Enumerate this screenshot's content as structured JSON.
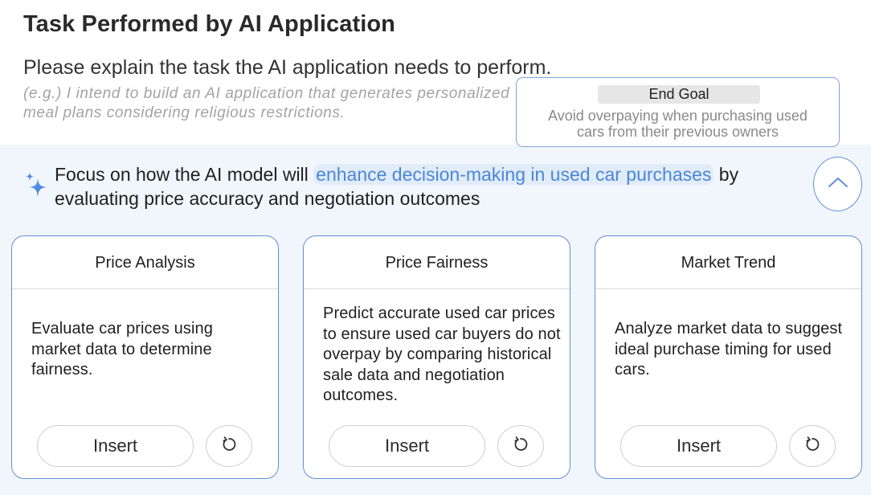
{
  "header": {
    "title": "Task Performed by AI Application",
    "question": "Please explain the task the AI application needs to perform.",
    "placeholder": "(e.g.) I intend to build an AI application that generates personalized meal plans considering religious restrictions."
  },
  "end_goal": {
    "label": "End Goal",
    "text_line1": "Avoid overpaying when purchasing used",
    "text_line2": "cars from their previous owners"
  },
  "focus": {
    "prefix": "Focus on how the AI model will ",
    "highlight": "enhance decision-making in used car purchases",
    "suffix": " by evaluating price accuracy and negotiation outcomes"
  },
  "icons": {
    "sparkle": "sparkle-icon",
    "collapse": "chevron-up-icon",
    "refresh": "refresh-icon"
  },
  "colors": {
    "accent": "#5f8fd6",
    "highlight_text": "#4a86d8",
    "panel_bg": "#f1f6fc"
  },
  "cards": [
    {
      "title": "Price Analysis",
      "body": "Evaluate car prices using market data to determine fairness.",
      "insert_label": "Insert"
    },
    {
      "title": "Price Fairness",
      "body": "Predict accurate used car prices to ensure used car buyers do not overpay by comparing historical sale data and negotiation outcomes.",
      "insert_label": "Insert"
    },
    {
      "title": "Market Trend",
      "body": "Analyze market data to suggest ideal purchase timing for used cars.",
      "insert_label": "Insert"
    }
  ]
}
